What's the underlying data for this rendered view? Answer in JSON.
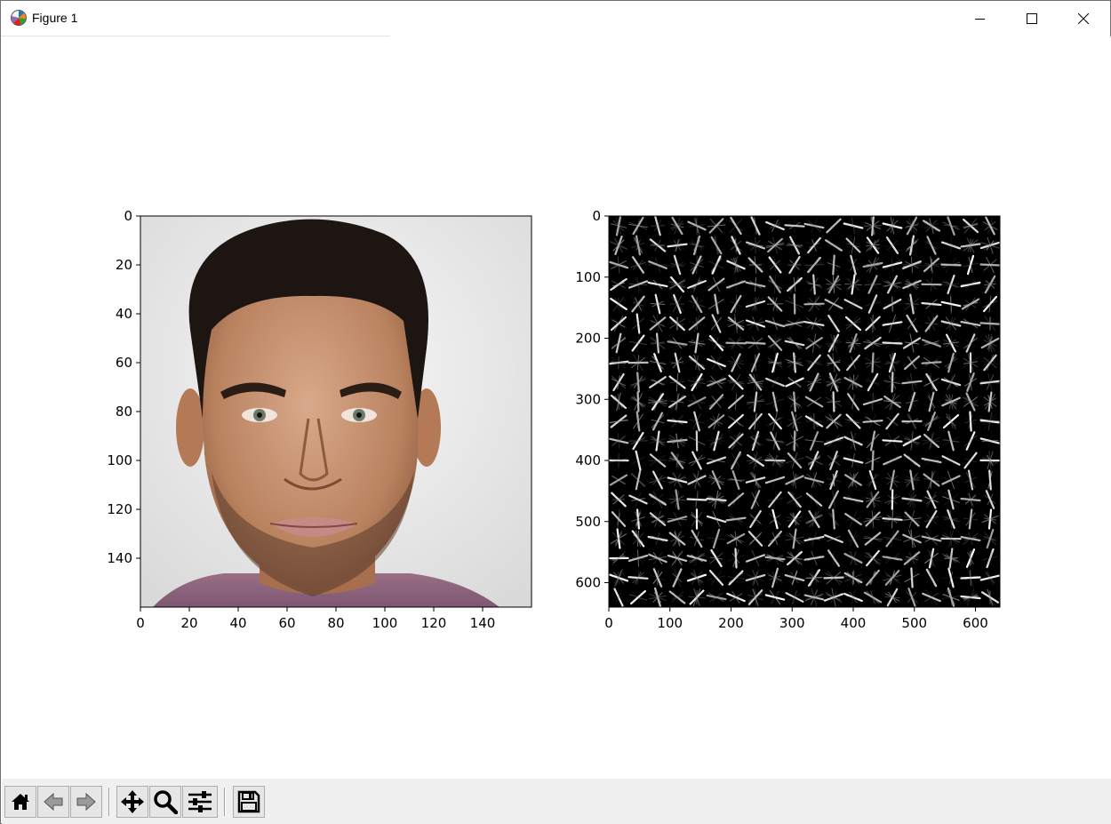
{
  "window": {
    "title": "Figure 1",
    "icon": "matplotlib-icon",
    "controls": [
      "minimize-icon",
      "maximize-icon",
      "close-icon"
    ]
  },
  "figure": {
    "subplots": [
      {
        "name": "face-image",
        "content": "color photograph of a man's face",
        "x_ticks": [
          "0",
          "20",
          "40",
          "60",
          "80",
          "100",
          "120",
          "140"
        ],
        "y_ticks": [
          "0",
          "20",
          "40",
          "60",
          "80",
          "100",
          "120",
          "140"
        ],
        "x_limit": [
          0,
          160
        ],
        "y_limit": [
          0,
          160
        ]
      },
      {
        "name": "hog-image",
        "content": "HOG feature visualization (grayscale orientation glyphs on black)",
        "x_ticks": [
          "0",
          "100",
          "200",
          "300",
          "400",
          "500",
          "600"
        ],
        "y_ticks": [
          "0",
          "100",
          "200",
          "300",
          "400",
          "500",
          "600"
        ],
        "x_limit": [
          0,
          640
        ],
        "y_limit": [
          0,
          640
        ],
        "grid_cells": [
          20,
          20
        ]
      }
    ]
  },
  "toolbar": {
    "buttons": [
      {
        "name": "home-button",
        "icon": "home-icon",
        "tooltip": "Reset original view"
      },
      {
        "name": "back-button",
        "icon": "arrow-left-icon",
        "tooltip": "Back to previous view"
      },
      {
        "name": "forward-button",
        "icon": "arrow-right-icon",
        "tooltip": "Forward to next view"
      },
      {
        "name": "pan-button",
        "icon": "move-icon",
        "tooltip": "Pan axes"
      },
      {
        "name": "zoom-button",
        "icon": "magnifier-icon",
        "tooltip": "Zoom to rectangle"
      },
      {
        "name": "configure-button",
        "icon": "sliders-icon",
        "tooltip": "Configure subplots"
      },
      {
        "name": "save-button",
        "icon": "floppy-disk-icon",
        "tooltip": "Save the figure"
      }
    ],
    "coordinates": ""
  }
}
